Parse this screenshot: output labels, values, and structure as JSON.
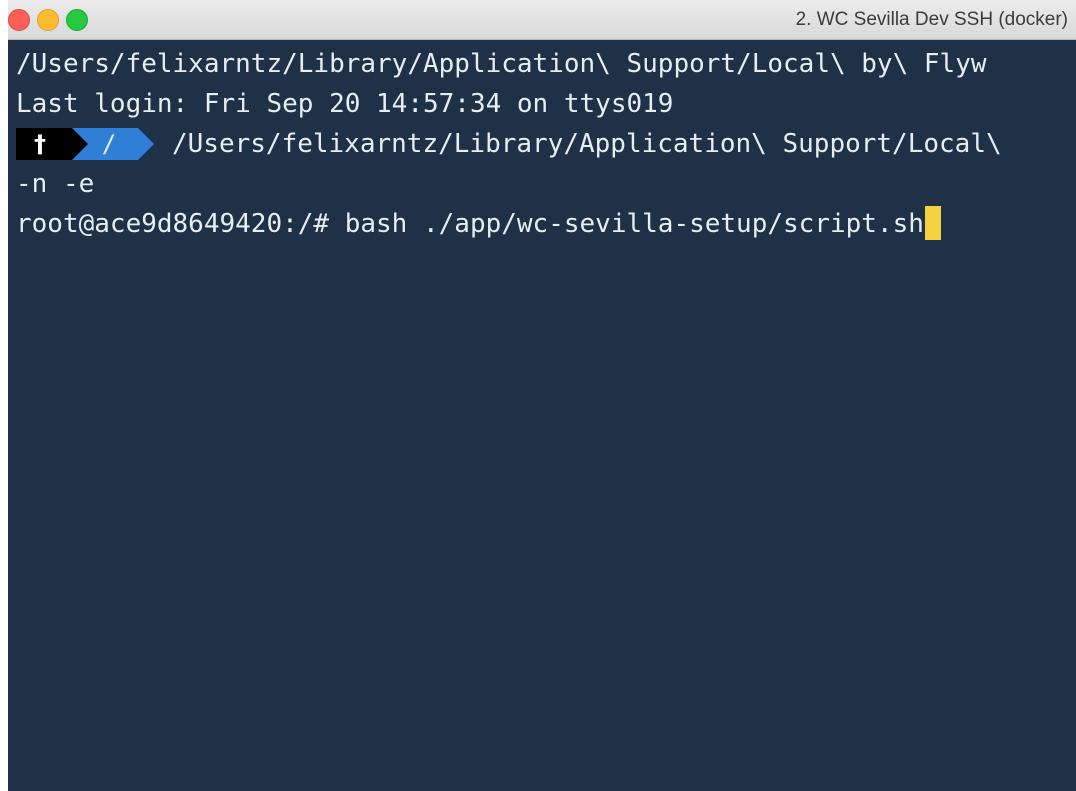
{
  "window": {
    "title": "2. WC Sevilla Dev SSH (docker)"
  },
  "terminal": {
    "line1": "/Users/felixarntz/Library/Application\\ Support/Local\\ by\\ Flyw",
    "line2": "Last login: Fri Sep 20 14:57:34 on ttys019",
    "prompt": {
      "root_symbol": "†",
      "dir_segment": "/",
      "path": "/Users/felixarntz/Library/Application\\ Support/Local\\"
    },
    "line4": "-n -e",
    "line5": "root@ace9d8649420:/# bash ./app/wc-sevilla-setup/script.sh"
  },
  "colors": {
    "background": "#1e3146",
    "text": "#e8edf2",
    "cursor": "#f4d23e",
    "prompt_dir_segment": "#2f7fd6",
    "prompt_root_segment": "#000000"
  },
  "icons": {
    "close": "traffic-light-close-icon",
    "minimize": "traffic-light-minimize-icon",
    "maximize": "traffic-light-maximize-icon"
  }
}
